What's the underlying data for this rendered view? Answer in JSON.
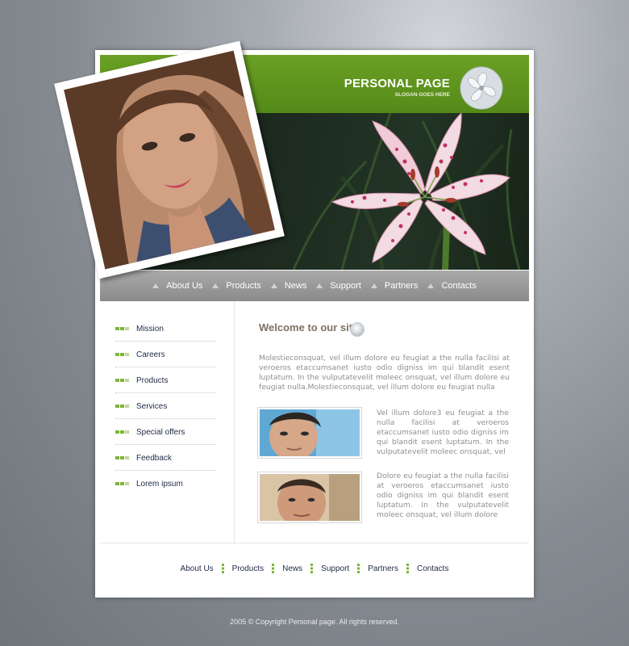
{
  "brand": {
    "title": "PERSONAL PAGE",
    "slogan": "SLOGAN GOES HERE"
  },
  "nav": {
    "items": [
      "About Us",
      "Products",
      "News",
      "Support",
      "Partners",
      "Contacts"
    ]
  },
  "sidebar": {
    "items": [
      "Mission",
      "Careers",
      "Products",
      "Services",
      "Special offers",
      "Feedback",
      "Lorem ipsum"
    ]
  },
  "main": {
    "heading": "Welcome to our site",
    "intro": "Molestieconsquat, vel illum dolore eu feugiat a the nulla facilisi at veroeros etaccumsanet iusto odio digniss im qui blandit esent luptatum. In the vulputatevelit moleec onsquat, vel illum dolore eu feugiat nulla.Molestieconsquat, vel illum dolore eu feugiat nulla",
    "items": [
      {
        "text": "Vel illum dolore3 eu feugiat a the nulla facilisi at veroeros etaccumsanet iusto odio digniss im qui blandit esent luptatum. In the vulputatevelit moleec onsquat, vel"
      },
      {
        "text": "Dolore eu feugiat a the nulla facilisi at veroeros etaccumsanet iusto odio digniss im qui blandit esent luptatum. In the vulputatevelit moleec onsquat, vel illum dolore"
      }
    ]
  },
  "footer": {
    "items": [
      "About Us",
      "Products",
      "News",
      "Support",
      "Partners",
      "Contacts"
    ],
    "copyright": "2005 © Copyright Personal page. All rights reserved."
  },
  "colors": {
    "accent_green": "#5b9220",
    "nav_gray": "#999999",
    "heading_brown": "#7d7160"
  }
}
